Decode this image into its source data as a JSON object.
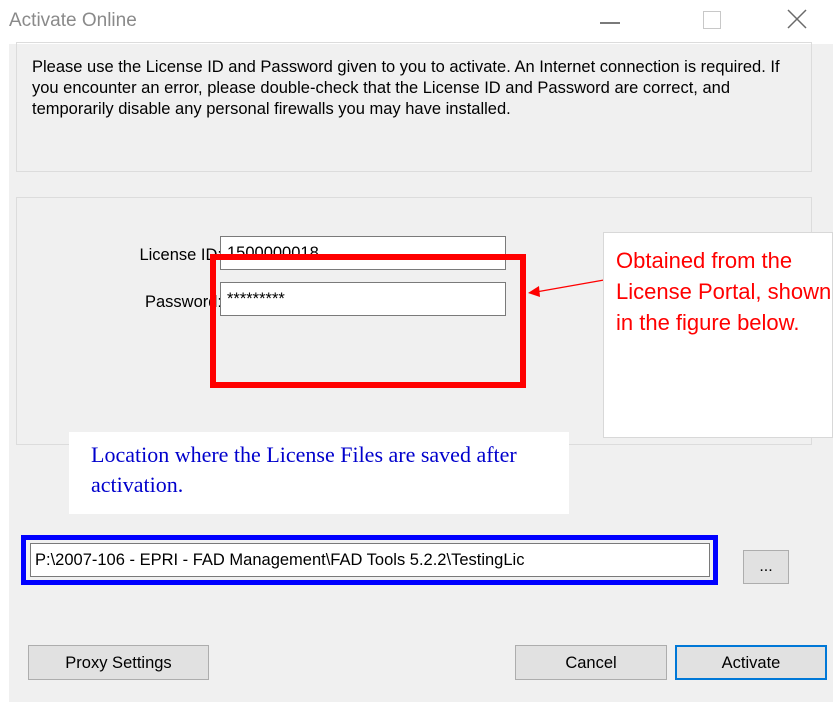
{
  "window": {
    "title": "Activate Online"
  },
  "info": {
    "text": "Please use the License ID and Password given to you to activate.  An Internet connection is required.  If you encounter an error, please double-check that the License ID and Password are correct, and temporarily disable any personal firewalls you may have installed."
  },
  "form": {
    "license_label": "License ID:",
    "license_value": "1500000018",
    "password_label": "Password:",
    "password_value": "*********"
  },
  "annotations": {
    "red_note": "Obtained from the License Portal, shown in the figure below.",
    "blue_note": "Location where the License Files are saved after activation.",
    "red_color": "#ff0000",
    "blue_color": "#0000ff"
  },
  "location": {
    "path": "P:\\2007-106 - EPRI - FAD Management\\FAD Tools 5.2.2\\TestingLic",
    "browse_label": "..."
  },
  "buttons": {
    "proxy_label": "Proxy Settings",
    "cancel_label": "Cancel",
    "activate_label": "Activate"
  }
}
